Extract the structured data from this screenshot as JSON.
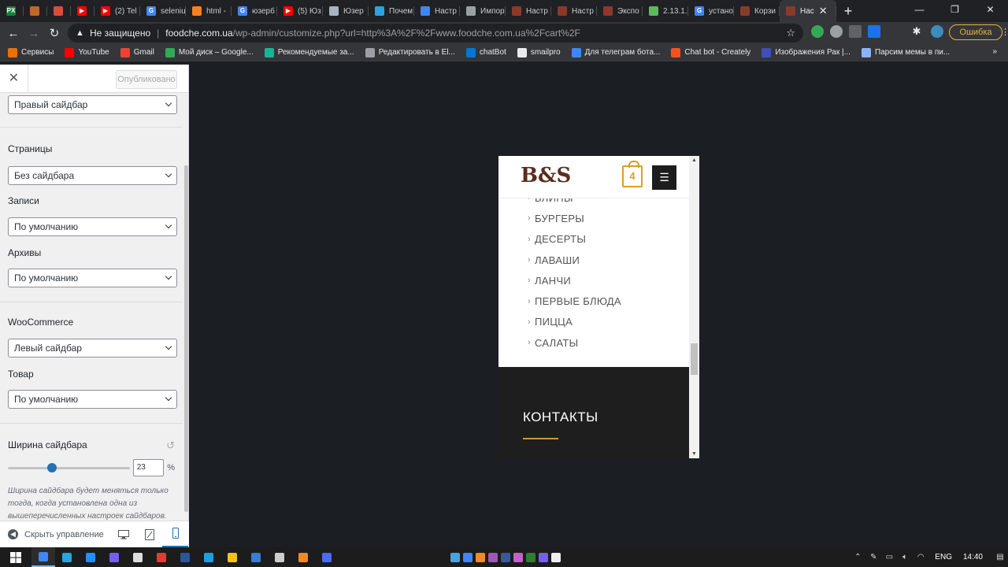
{
  "browser": {
    "tabs": [
      {
        "label": "",
        "color": "#1b7d3e",
        "glyph": "PX"
      },
      {
        "label": "",
        "color": "#c0672b",
        "glyph": ""
      },
      {
        "label": "",
        "color": "#d94b3a",
        "glyph": ""
      },
      {
        "label": "",
        "color": "#ff0000",
        "glyph": "▶"
      },
      {
        "label": "(2) Tel",
        "color": "#ff0000",
        "glyph": "▶"
      },
      {
        "label": "seleniu",
        "color": "#4285f4",
        "glyph": "G"
      },
      {
        "label": "html -",
        "color": "#f48024",
        "glyph": ""
      },
      {
        "label": "юзерб",
        "color": "#4285f4",
        "glyph": "G"
      },
      {
        "label": "(5) Юз",
        "color": "#ff0000",
        "glyph": "▶"
      },
      {
        "label": "Юзер",
        "color": "#aab2c0",
        "glyph": ""
      },
      {
        "label": "Почем",
        "color": "#2aa3e0",
        "glyph": ""
      },
      {
        "label": "Настр",
        "color": "#4285f4",
        "glyph": ""
      },
      {
        "label": "Импор",
        "color": "#9aa0a6",
        "glyph": ""
      },
      {
        "label": "Настр",
        "color": "#8b3a2a",
        "glyph": ""
      },
      {
        "label": "Настр",
        "color": "#8b3a2a",
        "glyph": ""
      },
      {
        "label": "Экспо",
        "color": "#8b3a2a",
        "glyph": ""
      },
      {
        "label": "2.13.1.",
        "color": "#5cb85c",
        "glyph": ""
      },
      {
        "label": "устано",
        "color": "#4285f4",
        "glyph": "G"
      },
      {
        "label": "Корзи",
        "color": "#8b3a2a",
        "glyph": ""
      },
      {
        "label": "Нас",
        "color": "#8b3a2a",
        "glyph": "",
        "active": true
      }
    ],
    "new_tab": "+",
    "url_insecure": "Не защищено",
    "url_host": "foodche.com.ua",
    "url_path": "/wp-admin/customize.php?url=http%3A%2F%2Fwww.foodche.com.ua%2Fcart%2F",
    "error_button": "Ошибка",
    "bookmarks": [
      {
        "label": "Сервисы",
        "color": "#e8710a"
      },
      {
        "label": "YouTube",
        "color": "#ff0000"
      },
      {
        "label": "Gmail",
        "color": "#ea4335"
      },
      {
        "label": "Мой диск – Google...",
        "color": "#34a853"
      },
      {
        "label": "Рекомендуемые за...",
        "color": "#1ab394"
      },
      {
        "label": "Редактировать в El...",
        "color": "#9aa0a6"
      },
      {
        "label": "chatBot",
        "color": "#0078d4"
      },
      {
        "label": "smailpro",
        "color": "#e8eaed"
      },
      {
        "label": "Для телеграм бота...",
        "color": "#4285f4"
      },
      {
        "label": "Chat bot - Creately",
        "color": "#f4511e"
      },
      {
        "label": "Изображения Рак |...",
        "color": "#3f51b5"
      },
      {
        "label": "Парсим мемы в пи...",
        "color": "#8ab4f8"
      }
    ],
    "bookmarks_more": "»"
  },
  "customizer": {
    "published_label": "Опубликовано",
    "top_select": "Правый сайдбар",
    "fields": [
      {
        "label": "Страницы",
        "value": "Без сайдбара"
      },
      {
        "label": "Записи",
        "value": "По умолчанию"
      },
      {
        "label": "Архивы",
        "value": "По умолчанию"
      },
      {
        "label": "WooCommerce",
        "value": "Левый сайдбар"
      },
      {
        "label": "Товар",
        "value": "По умолчанию"
      }
    ],
    "width_label": "Ширина сайдбара",
    "width_value": "23",
    "width_percent": 23,
    "width_unit": "%",
    "description": "Ширина сайдбара будет меняться только тогда, когда установлена одна из вышеперечисленных настроек сайдбаров.",
    "hide_controls": "Скрыть управление"
  },
  "preview": {
    "logo": "B&S",
    "cart_count": "4",
    "menu_items": [
      "БЛИНЫ",
      "БУРГЕРЫ",
      "ДЕСЕРТЫ",
      "ЛАВАШИ",
      "ЛАНЧИ",
      "ПЕРВЫЕ БЛЮДА",
      "ПИЦЦА",
      "САЛАТЫ"
    ],
    "contacts_title": "КОНТАКТЫ"
  },
  "taskbar": {
    "apps_left": [
      "#4285f4",
      "#2aa3e0",
      "#1e90ff",
      "#7360f2",
      "#dddddd",
      "#e53935",
      "#2b579a",
      "#1ba1e2",
      "#f0c419",
      "#3a7bd5",
      "#cccccc",
      "#f08a24",
      "#4a6cf7"
    ],
    "apps_mid": [
      "#4aa3df",
      "#4285f4",
      "#f08a24",
      "#9b59b6",
      "#3b5998",
      "#c45fcc",
      "#2e7d32",
      "#7360f2",
      "#eeeeee"
    ],
    "lang": "ENG",
    "time": "14:40"
  }
}
